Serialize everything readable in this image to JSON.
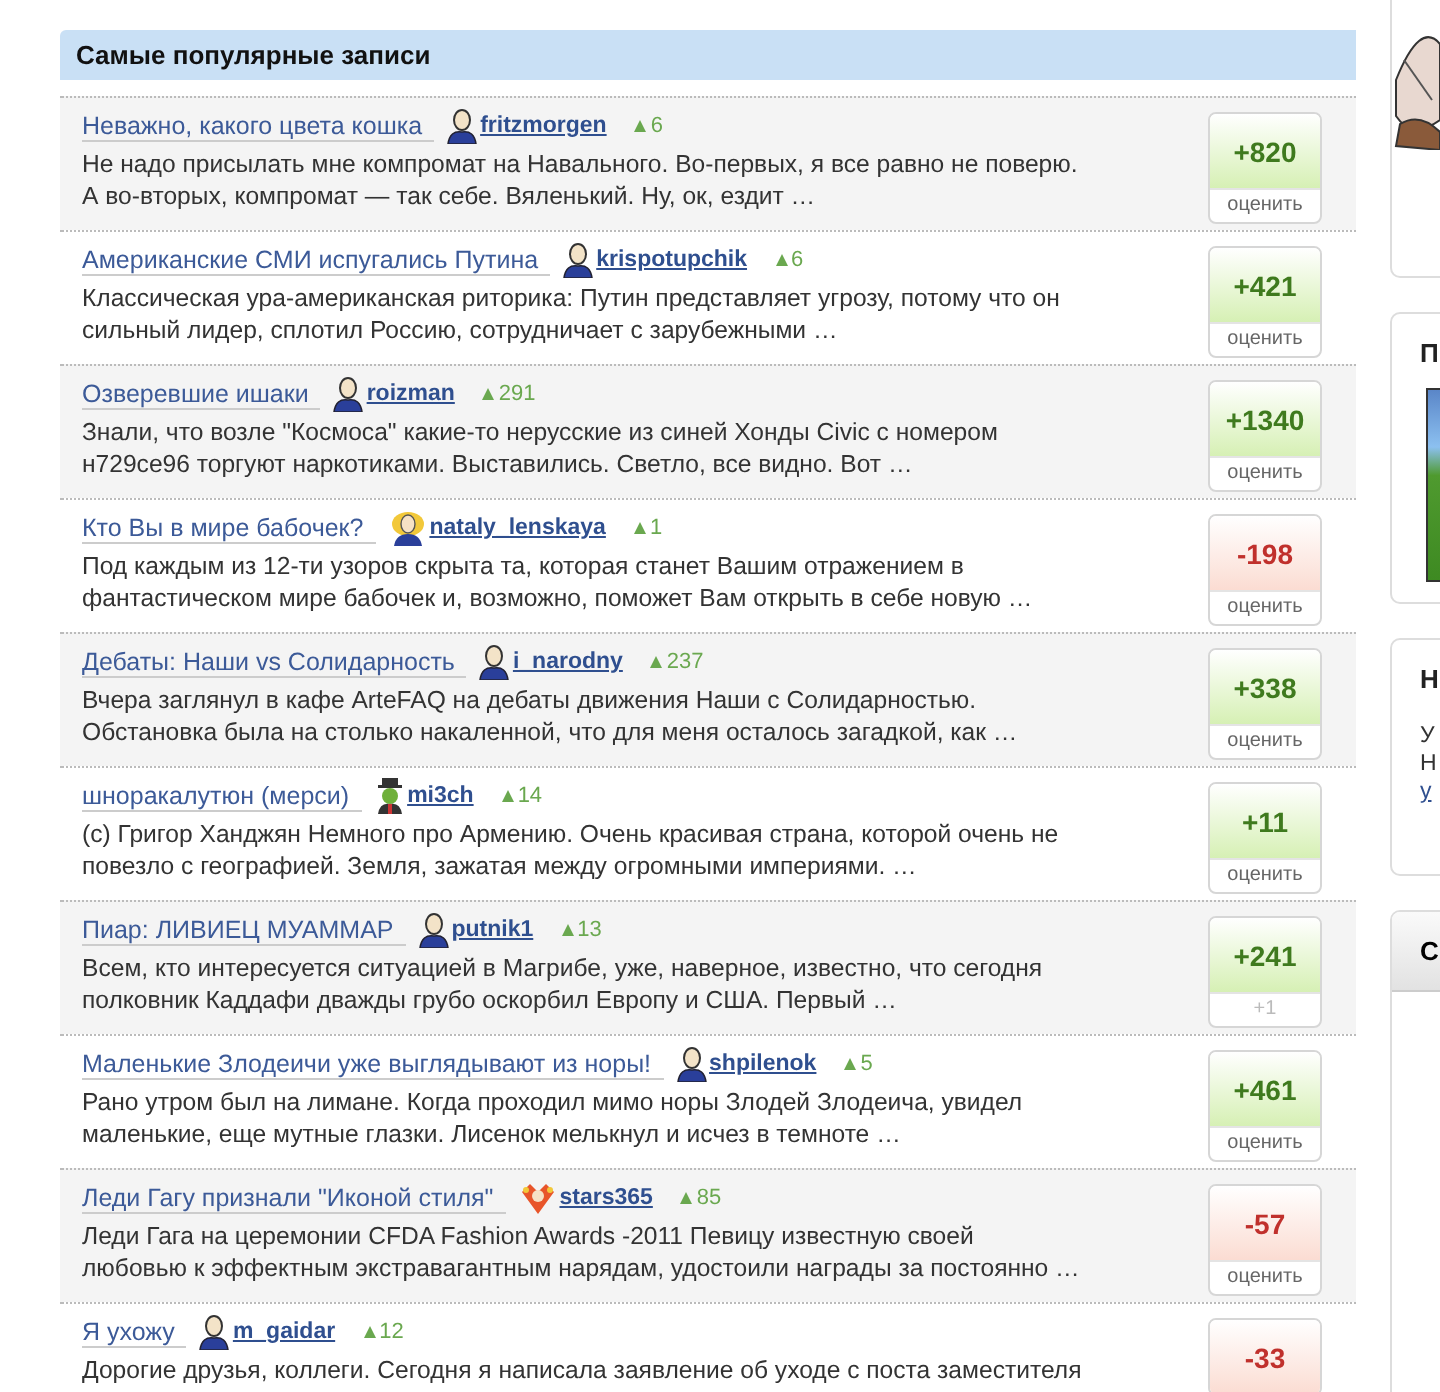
{
  "panel": {
    "title": "Самые популярные записи"
  },
  "posts": [
    {
      "title": "Неважно, какого цвета кошка",
      "author": "fritzmorgen",
      "avatar": {
        "kind": "male"
      },
      "rating": "6",
      "excerpt": "Не надо присылать мне компромат на Навального. Во-первых, я все равно не поверю. А во-вторых, компромат — так себе. Вяленький. Ну, ок, ездит …",
      "score": {
        "value": "+820",
        "kind": "positive",
        "footer": {
          "kind": "link",
          "text": "оценить"
        }
      }
    },
    {
      "title": "Американские СМИ испугались Путина",
      "author": "krispotupchik",
      "avatar": {
        "kind": "male"
      },
      "rating": "6",
      "excerpt": "Классическая ура-американская риторика: Путин представляет угрозу, потому что он сильный лидер, сплотил Россию, сотрудничает с зарубежными …",
      "score": {
        "value": "+421",
        "kind": "positive",
        "footer": {
          "kind": "link",
          "text": "оценить"
        }
      }
    },
    {
      "title": "Озверевшие ишаки",
      "author": "roizman",
      "avatar": {
        "kind": "male"
      },
      "rating": "291",
      "excerpt": "Знали, что возле \"Космоса\" какие-то нерусские из синей Хонды Civic с номером н729се96 торгуют наркотиками. Выставились. Светло, все видно. Вот …",
      "score": {
        "value": "+1340",
        "kind": "positive",
        "footer": {
          "kind": "link",
          "text": "оценить"
        }
      }
    },
    {
      "title": "Кто Вы в мире бабочек?",
      "author": "nataly_lenskaya",
      "avatar": {
        "kind": "female"
      },
      "rating": "1",
      "excerpt": "Под каждым из 12-ти узоров скрыта та, которая станет Вашим отражением в фантастическом мире бабочек и, возможно, поможет Вам открыть в себе новую …",
      "score": {
        "value": "-198",
        "kind": "negative",
        "footer": {
          "kind": "link",
          "text": "оценить"
        }
      }
    },
    {
      "title": "Дебаты: Наши vs Солидарность",
      "author": "i_narodny",
      "avatar": {
        "kind": "male"
      },
      "rating": "237",
      "excerpt": "Вчера заглянул в кафе ArteFAQ на дебаты движения Наши с Солидарностью. Обстановка была на столько накаленной, что для меня осталось загадкой, как …",
      "score": {
        "value": "+338",
        "kind": "positive",
        "footer": {
          "kind": "link",
          "text": "оценить"
        }
      }
    },
    {
      "title": "шноракалутюн (мерси)",
      "author": "mi3ch",
      "avatar": {
        "kind": "hat"
      },
      "rating": "14",
      "excerpt": "(с) Григор Ханджян Немного про Армению. Очень красивая страна, которой очень не повезло с географией. Земля, зажатая между огромными империями. …",
      "score": {
        "value": "+11",
        "kind": "positive",
        "footer": {
          "kind": "link",
          "text": "оценить"
        }
      }
    },
    {
      "title": "Пиар: ЛИВИЕЦ МУАММАР",
      "author": "putnik1",
      "avatar": {
        "kind": "male"
      },
      "rating": "13",
      "excerpt": "Всем, кто интересуется ситуацией в Магрибе, уже, наверное, известно, что сегодня полковник Каддафи дважды грубо оскорбил Европу и США. Первый …",
      "score": {
        "value": "+241",
        "kind": "positive",
        "footer": {
          "kind": "count",
          "text": "+1"
        }
      }
    },
    {
      "title": "Маленькие Злодеичи уже выглядывают из норы!",
      "author": "shpilenok",
      "avatar": {
        "kind": "male"
      },
      "rating": "5",
      "excerpt": "Рано утром был на лимане. Когда проходил мимо норы Злодей Злодеича, увидел маленькие, еще мутные глазки. Лисенок мелькнул и исчез в темноте …",
      "score": {
        "value": "+461",
        "kind": "positive",
        "footer": {
          "kind": "link",
          "text": "оценить"
        }
      }
    },
    {
      "title": "Леди Гагу признали \"Иконой стиля\"",
      "author": "stars365",
      "avatar": {
        "kind": "star"
      },
      "rating": "85",
      "excerpt": "Леди Гага на церемонии CFDA Fashion Awards -2011 Певицу известную своей любовью к эффектным экстравагантным нарядам, удостоили награды за постоянно …",
      "score": {
        "value": "-57",
        "kind": "negative",
        "footer": {
          "kind": "link",
          "text": "оценить"
        }
      }
    },
    {
      "title": "Я ухожу",
      "author": "m_gaidar",
      "avatar": {
        "kind": "male"
      },
      "rating": "12",
      "excerpt": "Дорогие друзья, коллеги. Сегодня я написала заявление об уходе с поста заместителя",
      "score": {
        "value": "-33",
        "kind": "negative"
      }
    }
  ],
  "sidebar": [
    {
      "kind": "illustration"
    },
    {
      "kind": "image",
      "title": "П"
    },
    {
      "kind": "text",
      "title": "Н",
      "lines": [
        {
          "text": "У",
          "link": false
        },
        {
          "text": "Н",
          "link": false
        },
        {
          "text": "у",
          "link": true
        }
      ]
    },
    {
      "kind": "tabbed",
      "title": "С"
    }
  ]
}
